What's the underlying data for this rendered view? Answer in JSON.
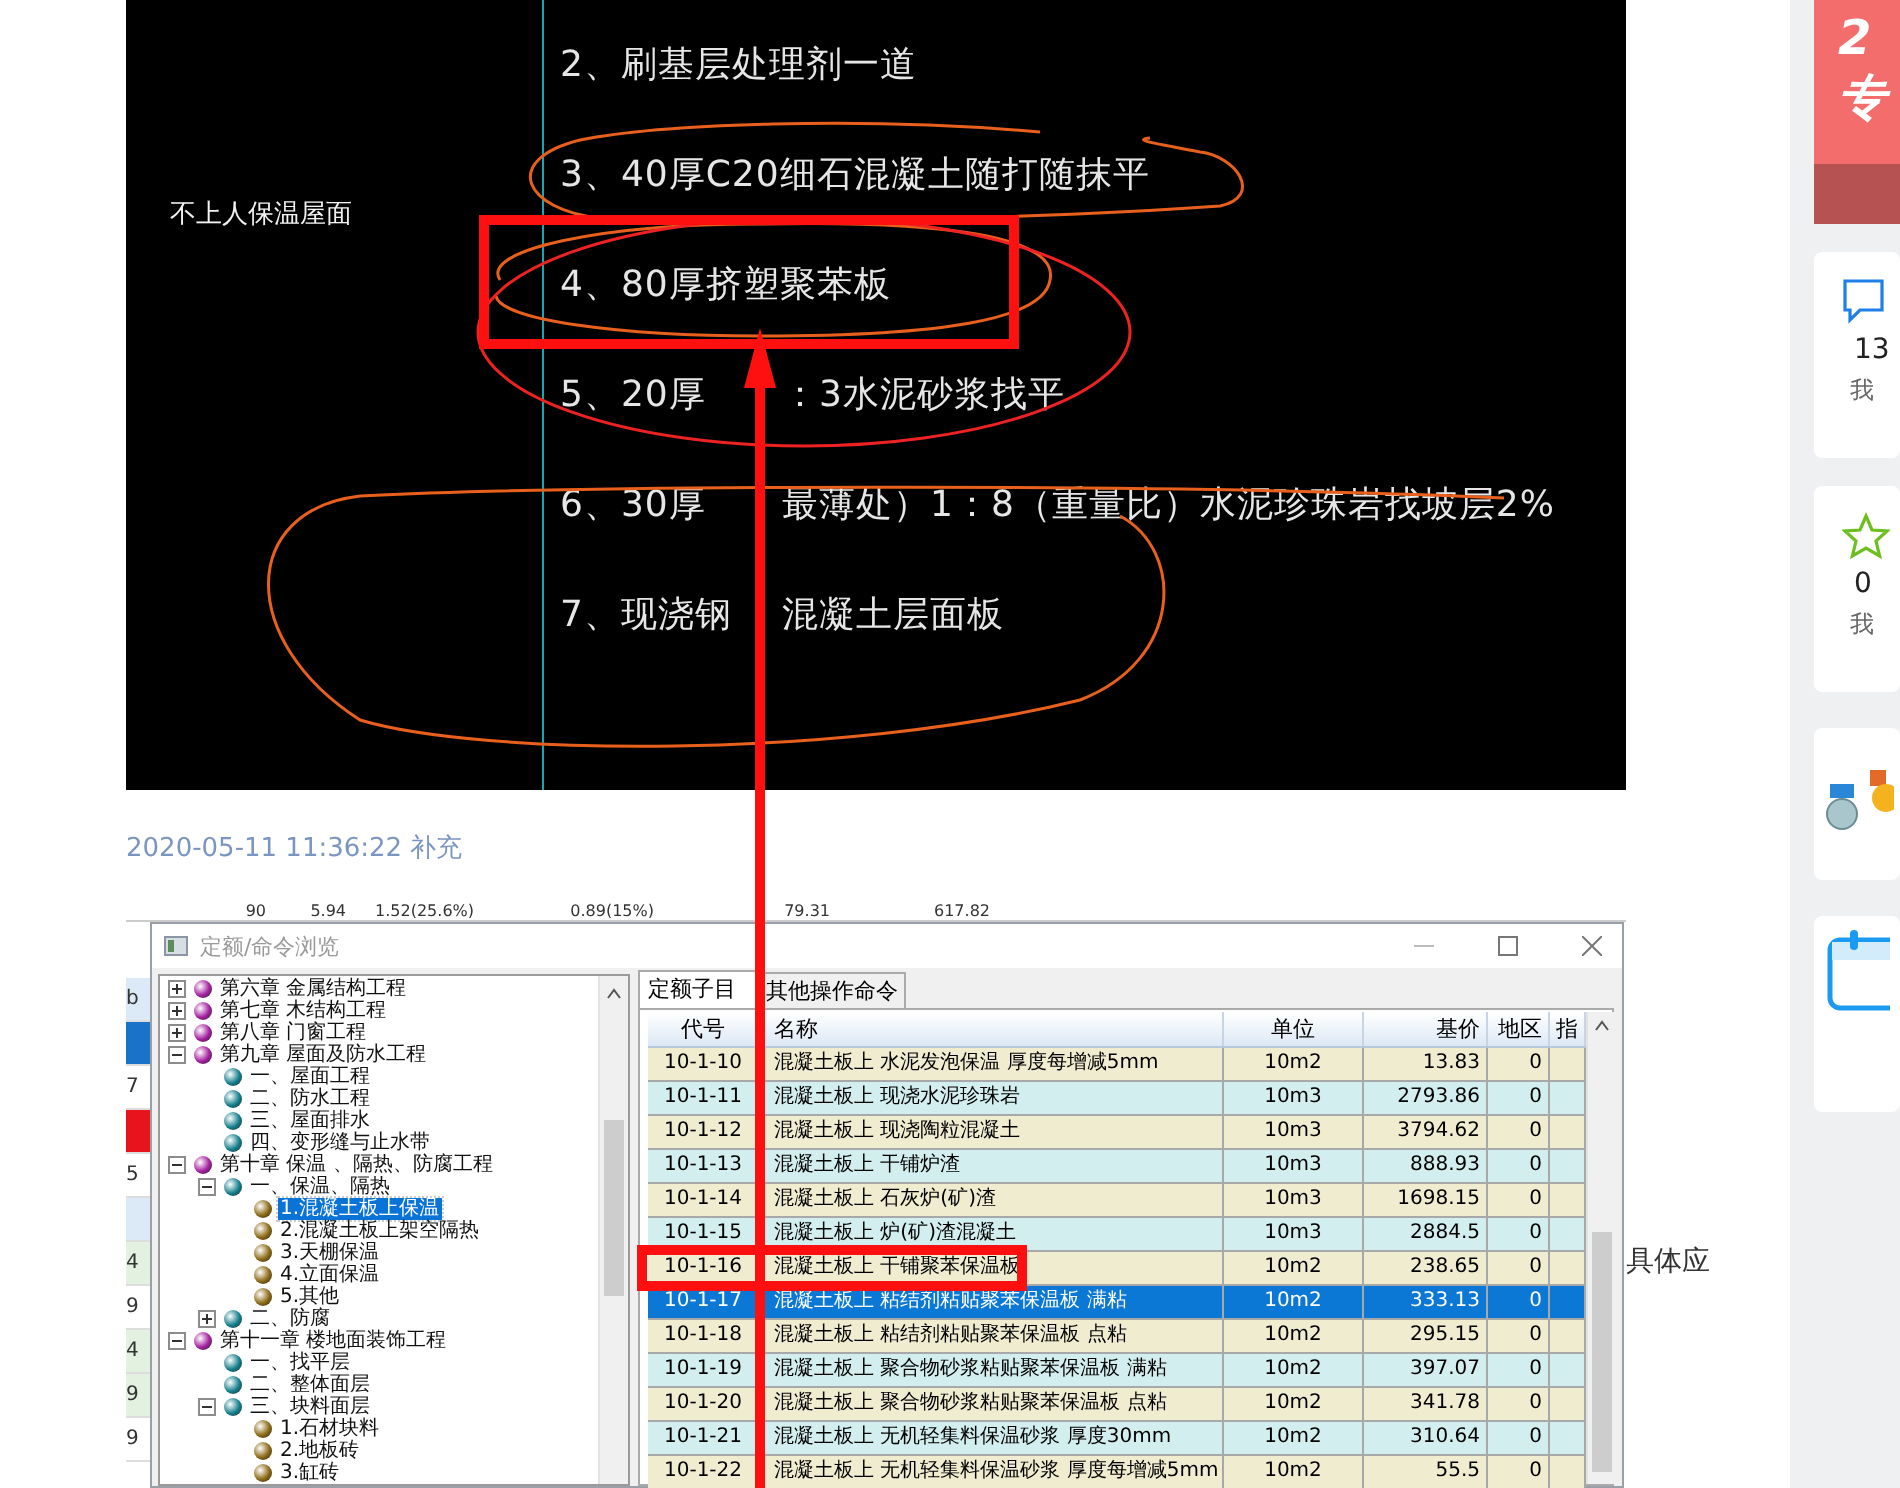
{
  "cad_drawing": {
    "label": "不上人保温屋面",
    "lines": [
      {
        "segments": [
          "2、刷基层处理剂一道"
        ]
      },
      {
        "segments": [
          "3、40厚C20细石混凝土随打随抹平"
        ]
      },
      {
        "segments": [
          "4、80厚挤塑聚苯板"
        ]
      },
      {
        "segments": [
          "5、20厚",
          "：3水泥砂浆找平"
        ]
      },
      {
        "segments": [
          "6、30厚",
          "最薄处）1：8（重量比）水泥珍珠岩找坡层2%"
        ]
      },
      {
        "segments": [
          "7、现浇钢",
          "混凝土层面板"
        ]
      }
    ]
  },
  "post": {
    "timestamp": "2020-05-11 11:36:22",
    "action": "补充",
    "trailing_text": "具体应"
  },
  "background_sheet": {
    "header_cells": [
      "90",
      "5.94",
      "1.52(25.6%)",
      "0.89(15%)",
      "79.31",
      "617.82"
    ],
    "side_cells": [
      {
        "text": "b",
        "kind": "light"
      },
      {
        "kind": "blue"
      },
      {
        "text": "7",
        "kind": "plain"
      },
      {
        "kind": "red"
      },
      {
        "text": "5",
        "kind": "plain"
      },
      {
        "kind": "light"
      },
      {
        "text": "4",
        "kind": "green"
      },
      {
        "text": "9",
        "kind": "plain"
      },
      {
        "text": "4",
        "kind": "green"
      },
      {
        "text": "9",
        "kind": "green"
      },
      {
        "text": "9",
        "kind": "plain"
      }
    ]
  },
  "dialog": {
    "title": "定额/命令浏览",
    "tree": [
      {
        "label": "第六章 金属结构工程",
        "expanded": false,
        "selected": false
      },
      {
        "label": "第七章 木结构工程",
        "expanded": false,
        "selected": false
      },
      {
        "label": "第八章 门窗工程",
        "expanded": false,
        "selected": false
      },
      {
        "label": "第九章 屋面及防水工程",
        "expanded": true,
        "selected": false,
        "children": [
          {
            "label": "一、屋面工程",
            "selected": false
          },
          {
            "label": "二、防水工程",
            "selected": false
          },
          {
            "label": "三、屋面排水",
            "selected": false
          },
          {
            "label": "四、变形缝与止水带",
            "selected": false
          }
        ]
      },
      {
        "label": "第十章 保温 、隔热、防腐工程",
        "expanded": true,
        "selected": false,
        "children": [
          {
            "label": "一、保温、隔热",
            "expanded": true,
            "selected": false,
            "children": [
              {
                "label": "1.混凝土板上保温",
                "selected": true
              },
              {
                "label": "2.混凝土板上架空隔热",
                "selected": false
              },
              {
                "label": "3.天棚保温",
                "selected": false
              },
              {
                "label": "4.立面保温",
                "selected": false
              },
              {
                "label": "5.其他",
                "selected": false
              }
            ]
          },
          {
            "label": "二、防腐",
            "expanded": false,
            "selected": false
          }
        ]
      },
      {
        "label": "第十一章 楼地面装饰工程",
        "expanded": true,
        "selected": false,
        "children": [
          {
            "label": "一、找平层",
            "selected": false
          },
          {
            "label": "二、整体面层",
            "selected": false
          },
          {
            "label": "三、块料面层",
            "expanded": true,
            "selected": false,
            "children": [
              {
                "label": "1.石材块料",
                "selected": false
              },
              {
                "label": "2.地板砖",
                "selected": false
              },
              {
                "label": "3.缸砖",
                "selected": false
              }
            ]
          }
        ]
      }
    ],
    "tabs": [
      {
        "label": "定额子目",
        "selected": true
      },
      {
        "label": "其他操作命令",
        "selected": false
      }
    ],
    "table": {
      "columns": [
        "代号",
        "名称",
        "单位",
        "基价",
        "地区",
        "指"
      ],
      "rows": [
        {
          "cells": [
            "10-1-10",
            "混凝土板上 水泥发泡保温 厚度每增减5mm",
            "10m2",
            "13.83",
            "0"
          ],
          "selected": false
        },
        {
          "cells": [
            "10-1-11",
            "混凝土板上 现浇水泥珍珠岩",
            "10m3",
            "2793.86",
            "0"
          ],
          "selected": false
        },
        {
          "cells": [
            "10-1-12",
            "混凝土板上 现浇陶粒混凝土",
            "10m3",
            "3794.62",
            "0"
          ],
          "selected": false
        },
        {
          "cells": [
            "10-1-13",
            "混凝土板上 干铺炉渣",
            "10m3",
            "888.93",
            "0"
          ],
          "selected": false
        },
        {
          "cells": [
            "10-1-14",
            "混凝土板上 石灰炉(矿)渣",
            "10m3",
            "1698.15",
            "0"
          ],
          "selected": false
        },
        {
          "cells": [
            "10-1-15",
            "混凝土板上 炉(矿)渣混凝土",
            "10m3",
            "2884.5",
            "0"
          ],
          "selected": false
        },
        {
          "cells": [
            "10-1-16",
            "混凝土板上 干铺聚苯保温板",
            "10m2",
            "238.65",
            "0"
          ],
          "selected": false
        },
        {
          "cells": [
            "10-1-17",
            "混凝土板上 粘结剂粘贴聚苯保温板 满粘",
            "10m2",
            "333.13",
            "0"
          ],
          "selected": true
        },
        {
          "cells": [
            "10-1-18",
            "混凝土板上 粘结剂粘贴聚苯保温板 点粘",
            "10m2",
            "295.15",
            "0"
          ],
          "selected": false
        },
        {
          "cells": [
            "10-1-19",
            "混凝土板上 聚合物砂浆粘贴聚苯保温板 满粘",
            "10m2",
            "397.07",
            "0"
          ],
          "selected": false
        },
        {
          "cells": [
            "10-1-20",
            "混凝土板上 聚合物砂浆粘贴聚苯保温板 点粘",
            "10m2",
            "341.78",
            "0"
          ],
          "selected": false
        },
        {
          "cells": [
            "10-1-21",
            "混凝土板上 无机轻集料保温砂浆 厚度30mm",
            "10m2",
            "310.64",
            "0"
          ],
          "selected": false
        },
        {
          "cells": [
            "10-1-22",
            "混凝土板上 无机轻集料保温砂浆 厚度每增减5mm",
            "10m2",
            "55.5",
            "0"
          ],
          "selected": false
        }
      ]
    }
  },
  "sidebar": {
    "banner": {
      "lines": [
        "2",
        "专"
      ]
    },
    "stat_cards": [
      {
        "kind": "edit",
        "count": "13",
        "label": "我"
      },
      {
        "kind": "star",
        "count": "0",
        "label": "我"
      }
    ]
  }
}
